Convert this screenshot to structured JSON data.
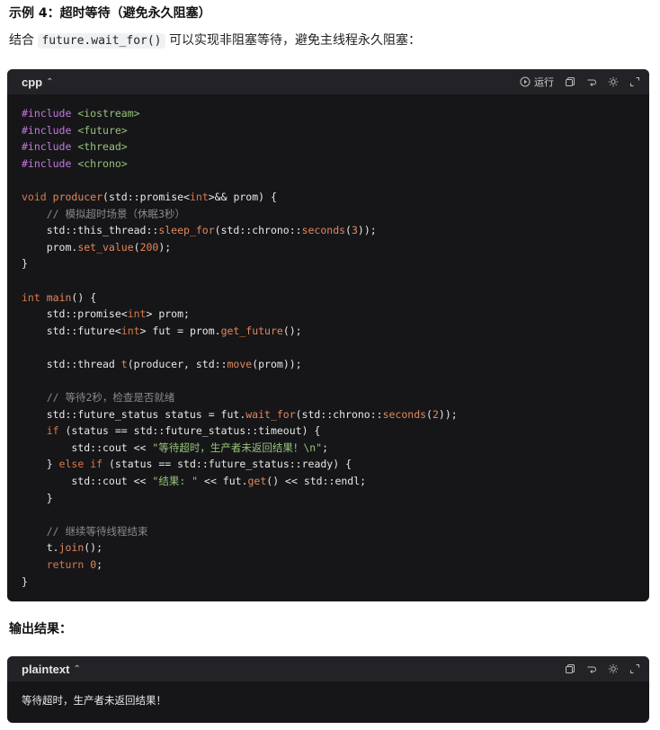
{
  "heading": "示例 4：超时等待（避免永久阻塞）",
  "description": {
    "before": "结合 ",
    "code": "future.wait_for()",
    "after": " 可以实现非阻塞等待，避免主线程永久阻塞："
  },
  "code_block": {
    "language": "cpp",
    "run_label": "运行",
    "lines": [
      [
        {
          "c": "pp",
          "t": "#include"
        },
        {
          "c": "",
          "t": " "
        },
        {
          "c": "inc",
          "t": "<iostream>"
        }
      ],
      [
        {
          "c": "pp",
          "t": "#include"
        },
        {
          "c": "",
          "t": " "
        },
        {
          "c": "inc",
          "t": "<future>"
        }
      ],
      [
        {
          "c": "pp",
          "t": "#include"
        },
        {
          "c": "",
          "t": " "
        },
        {
          "c": "inc",
          "t": "<thread>"
        }
      ],
      [
        {
          "c": "pp",
          "t": "#include"
        },
        {
          "c": "",
          "t": " "
        },
        {
          "c": "inc",
          "t": "<chrono>"
        }
      ],
      [],
      [
        {
          "c": "kw",
          "t": "void"
        },
        {
          "c": "",
          "t": " "
        },
        {
          "c": "fn",
          "t": "producer"
        },
        {
          "c": "",
          "t": "(std::promise<"
        },
        {
          "c": "ty",
          "t": "int"
        },
        {
          "c": "",
          "t": ">&& prom) {"
        }
      ],
      [
        {
          "c": "",
          "t": "    "
        },
        {
          "c": "cm",
          "t": "// 模拟超时场景（休眠3秒）"
        }
      ],
      [
        {
          "c": "",
          "t": "    std::this_thread::"
        },
        {
          "c": "fn",
          "t": "sleep_for"
        },
        {
          "c": "",
          "t": "(std::chrono::"
        },
        {
          "c": "fn",
          "t": "seconds"
        },
        {
          "c": "",
          "t": "("
        },
        {
          "c": "num",
          "t": "3"
        },
        {
          "c": "",
          "t": "));"
        }
      ],
      [
        {
          "c": "",
          "t": "    prom."
        },
        {
          "c": "fn",
          "t": "set_value"
        },
        {
          "c": "",
          "t": "("
        },
        {
          "c": "num",
          "t": "200"
        },
        {
          "c": "",
          "t": ");"
        }
      ],
      [
        {
          "c": "",
          "t": "}"
        }
      ],
      [],
      [
        {
          "c": "kw",
          "t": "int"
        },
        {
          "c": "",
          "t": " "
        },
        {
          "c": "fn",
          "t": "main"
        },
        {
          "c": "",
          "t": "() {"
        }
      ],
      [
        {
          "c": "",
          "t": "    std::promise<"
        },
        {
          "c": "ty",
          "t": "int"
        },
        {
          "c": "",
          "t": "> prom;"
        }
      ],
      [
        {
          "c": "",
          "t": "    std::future<"
        },
        {
          "c": "ty",
          "t": "int"
        },
        {
          "c": "",
          "t": "> fut = prom."
        },
        {
          "c": "fn",
          "t": "get_future"
        },
        {
          "c": "",
          "t": "();"
        }
      ],
      [],
      [
        {
          "c": "",
          "t": "    std::thread "
        },
        {
          "c": "fn",
          "t": "t"
        },
        {
          "c": "",
          "t": "(producer, std::"
        },
        {
          "c": "fn",
          "t": "move"
        },
        {
          "c": "",
          "t": "(prom));"
        }
      ],
      [],
      [
        {
          "c": "",
          "t": "    "
        },
        {
          "c": "cm",
          "t": "// 等待2秒，检查是否就绪"
        }
      ],
      [
        {
          "c": "",
          "t": "    std::future_status status = fut."
        },
        {
          "c": "fn",
          "t": "wait_for"
        },
        {
          "c": "",
          "t": "(std::chrono::"
        },
        {
          "c": "fn",
          "t": "seconds"
        },
        {
          "c": "",
          "t": "("
        },
        {
          "c": "num",
          "t": "2"
        },
        {
          "c": "",
          "t": "));"
        }
      ],
      [
        {
          "c": "",
          "t": "    "
        },
        {
          "c": "kw",
          "t": "if"
        },
        {
          "c": "",
          "t": " (status == std::future_status::timeout) {"
        }
      ],
      [
        {
          "c": "",
          "t": "        std::cout << "
        },
        {
          "c": "str",
          "t": "\"等待超时，生产者未返回结果！\\n\""
        },
        {
          "c": "",
          "t": ";"
        }
      ],
      [
        {
          "c": "",
          "t": "    } "
        },
        {
          "c": "kw",
          "t": "else"
        },
        {
          "c": "",
          "t": " "
        },
        {
          "c": "kw",
          "t": "if"
        },
        {
          "c": "",
          "t": " (status == std::future_status::ready) {"
        }
      ],
      [
        {
          "c": "",
          "t": "        std::cout << "
        },
        {
          "c": "str",
          "t": "\"结果: \""
        },
        {
          "c": "",
          "t": " << fut."
        },
        {
          "c": "fn",
          "t": "get"
        },
        {
          "c": "",
          "t": "() << std::endl;"
        }
      ],
      [
        {
          "c": "",
          "t": "    }"
        }
      ],
      [],
      [
        {
          "c": "",
          "t": "    "
        },
        {
          "c": "cm",
          "t": "// 继续等待线程结束"
        }
      ],
      [
        {
          "c": "",
          "t": "    t."
        },
        {
          "c": "fn",
          "t": "join"
        },
        {
          "c": "",
          "t": "();"
        }
      ],
      [
        {
          "c": "",
          "t": "    "
        },
        {
          "c": "kw",
          "t": "return"
        },
        {
          "c": "",
          "t": " "
        },
        {
          "c": "num",
          "t": "0"
        },
        {
          "c": "",
          "t": ";"
        }
      ],
      [
        {
          "c": "",
          "t": "}"
        }
      ]
    ]
  },
  "output_heading": "输出结果：",
  "output_block": {
    "language": "plaintext",
    "lines": [
      "等待超时，生产者未返回结果！"
    ]
  },
  "icons": {
    "run": "play-circle-icon",
    "copy": "copy-icon",
    "wrap": "wrap-arrow-icon",
    "theme": "sun-icon",
    "expand": "expand-icon",
    "lang_toggle": "chevron-up-icon"
  },
  "colors": {
    "code_bg": "#161619",
    "header_bg": "#232327",
    "keyword": "#d97a47",
    "preprocessor": "#c678dd",
    "string": "#98c379",
    "comment": "#8a8a8a"
  }
}
